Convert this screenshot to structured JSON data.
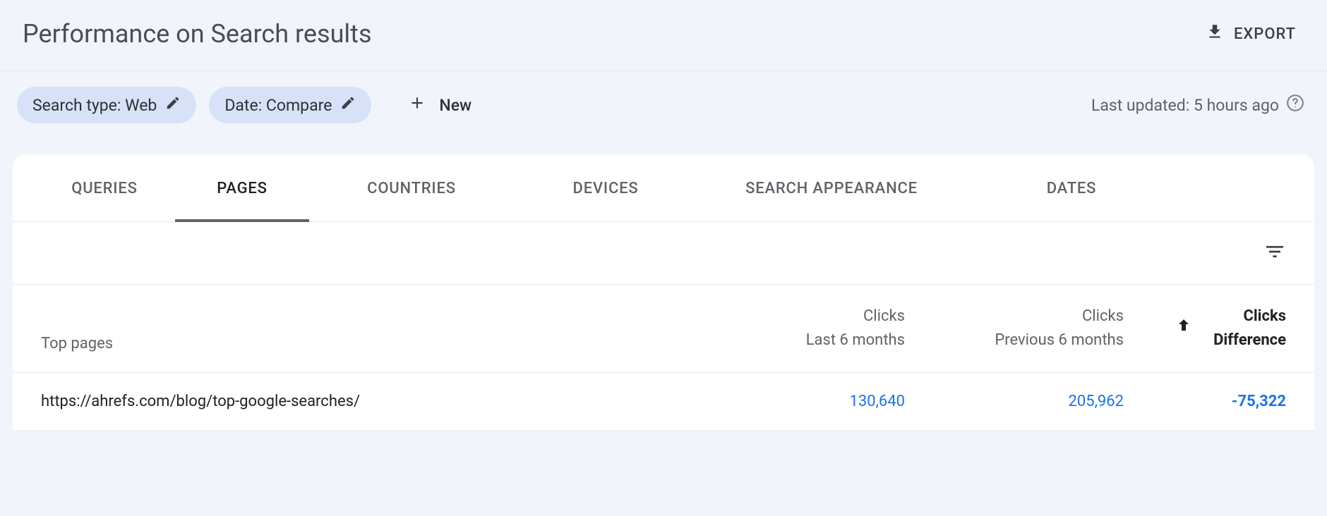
{
  "header": {
    "title": "Performance on Search results",
    "export_label": "EXPORT"
  },
  "filters": {
    "search_type_chip": "Search type: Web",
    "date_chip": "Date: Compare",
    "new_label": "New",
    "last_updated": "Last updated: 5 hours ago"
  },
  "tabs": {
    "queries": "QUERIES",
    "pages": "PAGES",
    "countries": "COUNTRIES",
    "devices": "DEVICES",
    "search_appearance": "SEARCH APPEARANCE",
    "dates": "DATES"
  },
  "table": {
    "columns": {
      "top_pages": "Top pages",
      "clicks_current_l1": "Clicks",
      "clicks_current_l2": "Last 6 months",
      "clicks_prev_l1": "Clicks",
      "clicks_prev_l2": "Previous 6 months",
      "diff_l1": "Clicks",
      "diff_l2": "Difference"
    },
    "rows": [
      {
        "page": "https://ahrefs.com/blog/top-google-searches/",
        "clicks_current": "130,640",
        "clicks_previous": "205,962",
        "difference": "-75,322"
      }
    ]
  }
}
